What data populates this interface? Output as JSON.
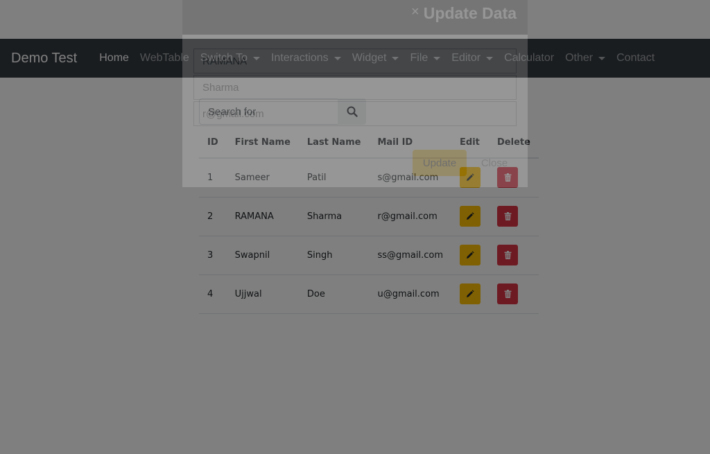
{
  "navbar": {
    "brand": "Demo Test",
    "items": [
      {
        "label": "Home",
        "active": true,
        "dropdown": false
      },
      {
        "label": "WebTable",
        "active": false,
        "dropdown": false
      },
      {
        "label": "Switch To",
        "active": false,
        "dropdown": true
      },
      {
        "label": "Interactions",
        "active": false,
        "dropdown": true
      },
      {
        "label": "Widget",
        "active": false,
        "dropdown": true
      },
      {
        "label": "File",
        "active": false,
        "dropdown": true
      },
      {
        "label": "Editor",
        "active": false,
        "dropdown": true
      },
      {
        "label": "Calculator",
        "active": false,
        "dropdown": false
      },
      {
        "label": "Other",
        "active": false,
        "dropdown": true
      },
      {
        "label": "Contact",
        "active": false,
        "dropdown": false
      }
    ]
  },
  "search": {
    "placeholder": "Search for",
    "icon": "search-icon"
  },
  "table": {
    "headers": [
      "ID",
      "First Name",
      "Last Name",
      "Mail ID",
      "Edit",
      "Delete"
    ],
    "rows": [
      {
        "id": "1",
        "first": "Sameer",
        "last": "Patil",
        "mail": "s@gmail.com"
      },
      {
        "id": "2",
        "first": "RAMANA",
        "last": "Sharma",
        "mail": "r@gmail.com"
      },
      {
        "id": "3",
        "first": "Swapnil",
        "last": "Singh",
        "mail": "ss@gmail.com"
      },
      {
        "id": "4",
        "first": "Ujjwal",
        "last": "Doe",
        "mail": "u@gmail.com"
      }
    ],
    "edit_icon": "pencil-icon",
    "delete_icon": "trash-icon"
  },
  "modal": {
    "title": "Update Data",
    "close_symbol": "×",
    "fields": {
      "first_name": "RAMANA",
      "last_name": "Sharma",
      "email": "r@gmail.com"
    },
    "update_label": "Update",
    "close_label": "Close"
  },
  "colors": {
    "navbar_bg": "#343a40",
    "edit": "#ffc107",
    "delete": "#dc3545",
    "backdrop": "rgba(0,0,0,0.5)"
  }
}
